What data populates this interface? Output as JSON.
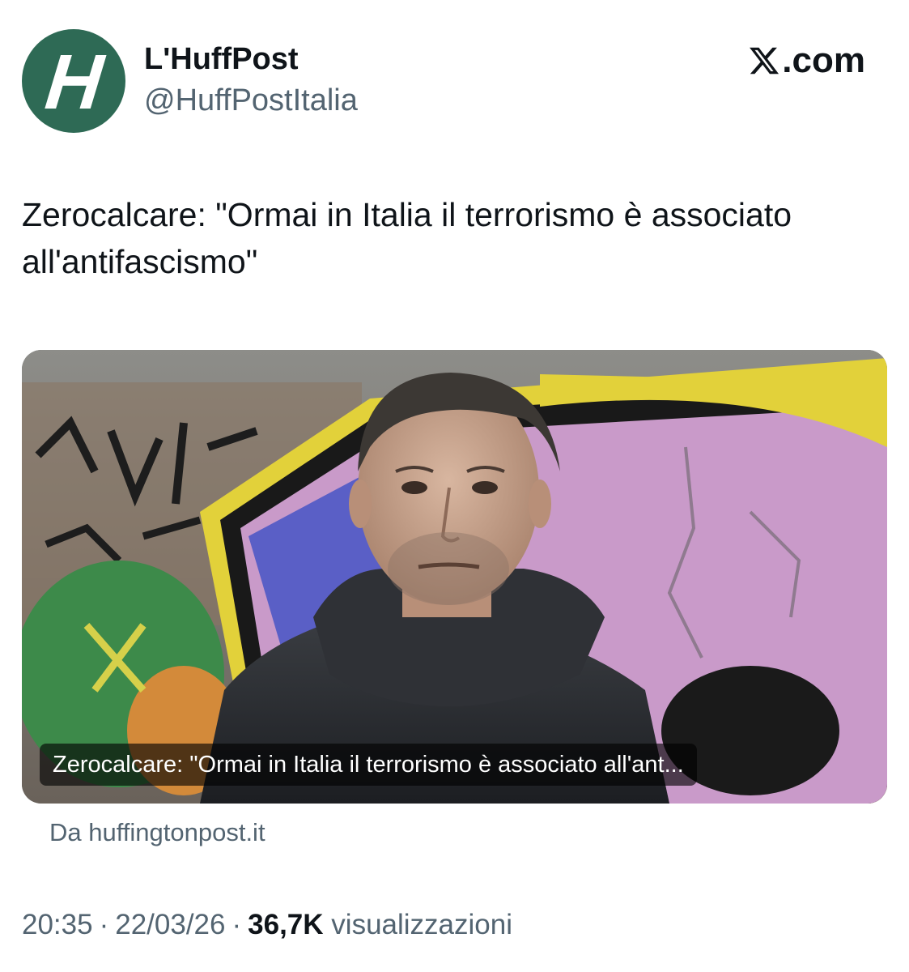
{
  "header": {
    "author_name": "L'HuffPost",
    "author_handle": "@HuffPostItalia",
    "avatar_letter": "H",
    "brand_label": ".com",
    "brand_icon": "x-logo-icon"
  },
  "tweet": {
    "text": "Zerocalcare: \"Ormai in Italia il terrorismo è associato all'antifascismo\""
  },
  "card": {
    "caption": "Zerocalcare: \"Ormai in Italia il terrorismo è associato all'ant...",
    "source": "Da huffingtonpost.it"
  },
  "meta": {
    "time": "20:35",
    "separator": "·",
    "date": "22/03/26",
    "views_count": "36,7K",
    "views_label": "visualizzazioni"
  },
  "colors": {
    "avatar_bg": "#2e6a55",
    "text_primary": "#0f1419",
    "text_secondary": "#536471"
  }
}
